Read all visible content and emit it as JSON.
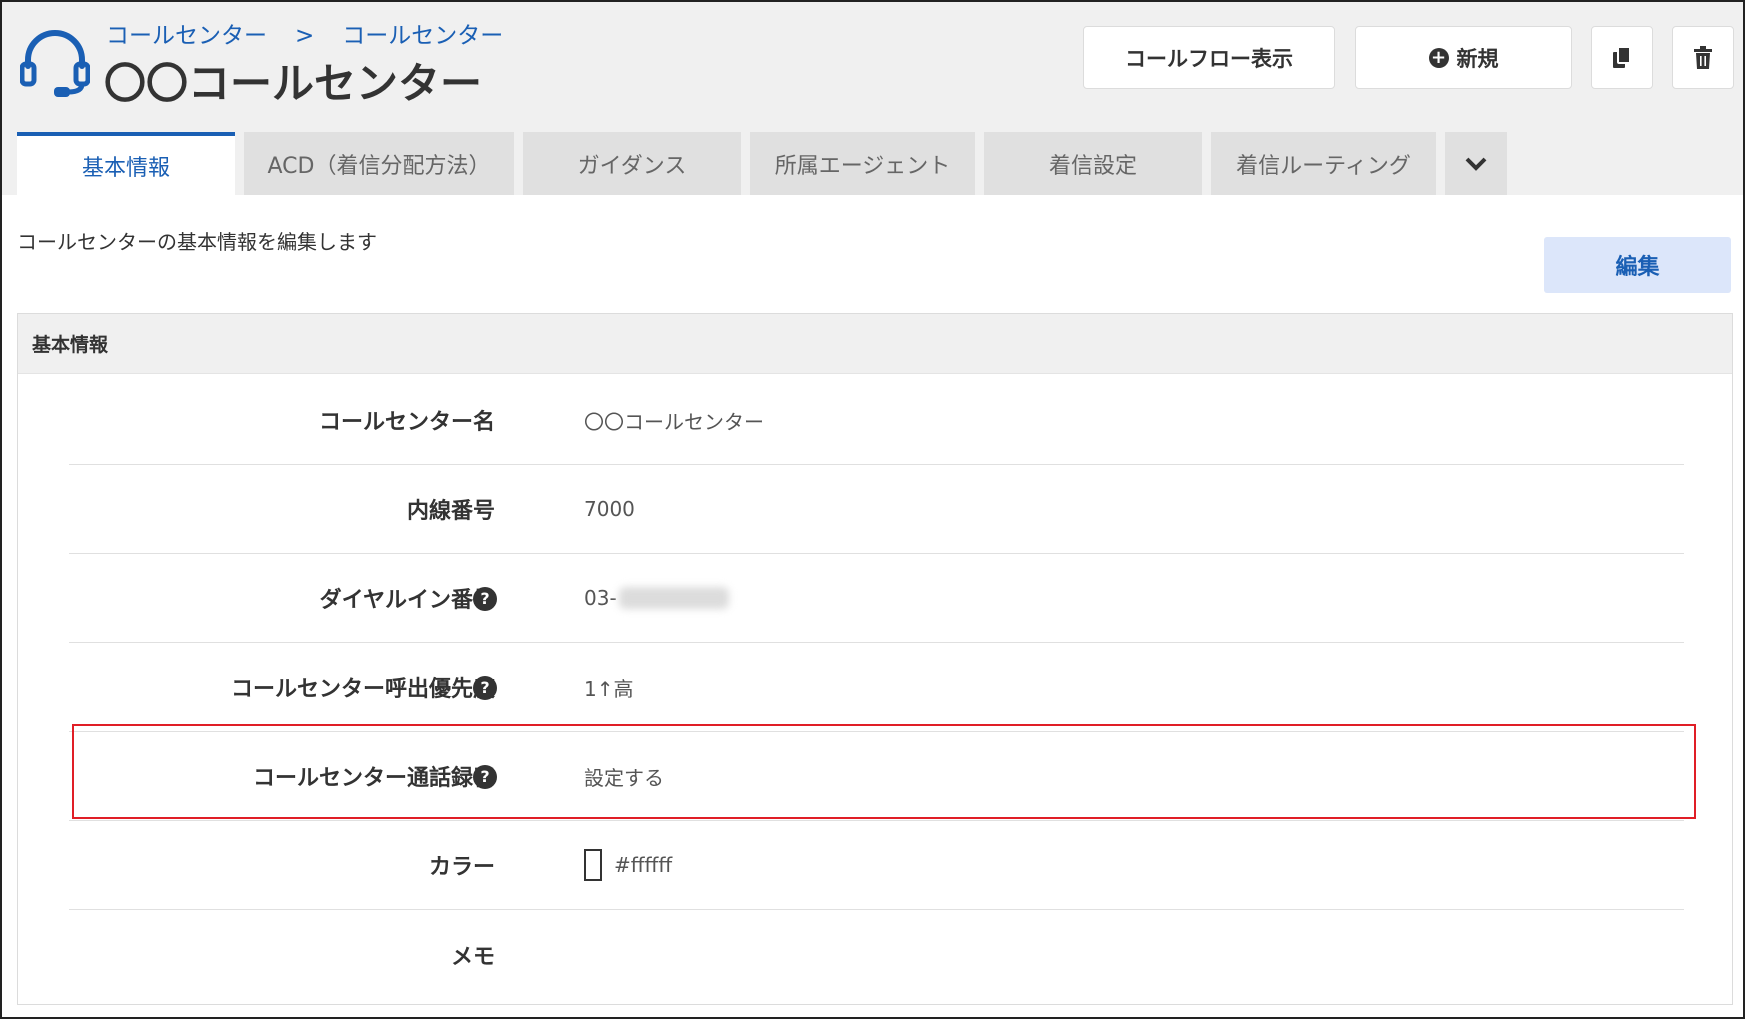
{
  "header": {
    "breadcrumb": [
      "コールセンター",
      "コールセンター"
    ],
    "breadcrumb_separator": ">",
    "title": "〇〇コールセンター",
    "buttons": {
      "callflow": "コールフロー表示",
      "new": "新規"
    }
  },
  "tabs": [
    {
      "label": "基本情報",
      "active": true
    },
    {
      "label": "ACD（着信分配方法）",
      "active": false
    },
    {
      "label": "ガイダンス",
      "active": false
    },
    {
      "label": "所属エージェント",
      "active": false
    },
    {
      "label": "着信設定",
      "active": false
    },
    {
      "label": "着信ルーティング",
      "active": false
    }
  ],
  "main": {
    "description": "コールセンターの基本情報を編集します",
    "edit_button": "編集",
    "panel_title": "基本情報",
    "fields": [
      {
        "label": "コールセンター名",
        "value": "〇〇コールセンター",
        "help": false
      },
      {
        "label": "内線番号",
        "value": "7000",
        "help": false
      },
      {
        "label": "ダイヤルイン番号",
        "value": "03-",
        "help": true,
        "value_redacted": true
      },
      {
        "label": "コールセンター呼出優先度",
        "value": "1↑高",
        "help": true
      },
      {
        "label": "コールセンター通話録音",
        "value": "設定する",
        "help": true,
        "highlighted": true
      },
      {
        "label": "カラー",
        "value": "#ffffff",
        "help": false,
        "swatch_color": "#ffffff"
      },
      {
        "label": "メモ",
        "value": "",
        "help": false
      }
    ]
  },
  "colors": {
    "accent": "#1a5fb4",
    "highlight_border": "#e01e26",
    "header_bg": "#f0f0f0",
    "edit_button_bg": "#dce6fa"
  },
  "icons": {
    "app": "headset-icon",
    "new": "plus-circle-icon",
    "copy": "copy-icon",
    "delete": "trash-icon",
    "more_tabs": "chevron-down-icon",
    "help": "question-circle-icon"
  }
}
